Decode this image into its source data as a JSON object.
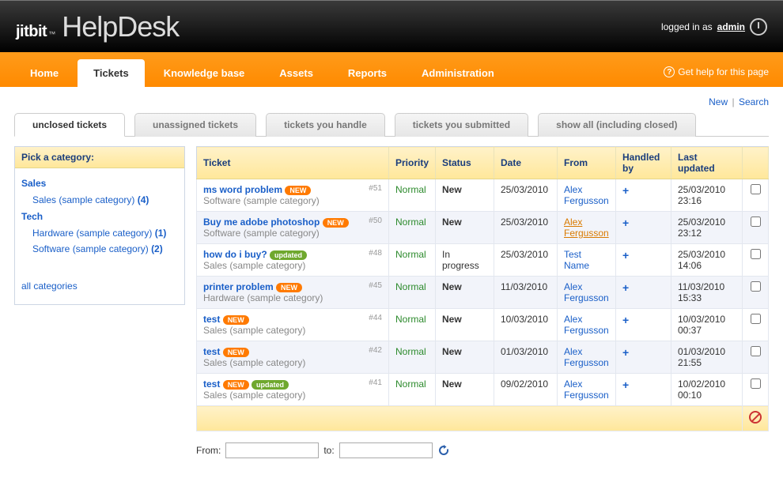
{
  "brand": {
    "jitbit": "jitbit",
    "tm": "™",
    "product": "HelpDesk"
  },
  "login": {
    "prefix": "logged in as ",
    "user": "admin"
  },
  "nav": {
    "tabs": [
      {
        "label": "Home"
      },
      {
        "label": "Tickets",
        "active": true
      },
      {
        "label": "Knowledge base"
      },
      {
        "label": "Assets"
      },
      {
        "label": "Reports"
      },
      {
        "label": "Administration"
      }
    ],
    "help": "Get help for this page"
  },
  "toplinks": {
    "new": "New",
    "search": "Search"
  },
  "subtabs": [
    {
      "label": "unclosed tickets",
      "active": true
    },
    {
      "label": "unassigned tickets"
    },
    {
      "label": "tickets you handle"
    },
    {
      "label": "tickets you submitted"
    },
    {
      "label": "show all (including closed)"
    }
  ],
  "sidebar": {
    "title": "Pick a category:",
    "groups": [
      {
        "name": "Sales",
        "items": [
          {
            "label": "Sales (sample category)",
            "count": "(4)"
          }
        ]
      },
      {
        "name": "Tech",
        "items": [
          {
            "label": "Hardware (sample category)",
            "count": "(1)"
          },
          {
            "label": "Software (sample category)",
            "count": "(2)"
          }
        ]
      }
    ],
    "all": "all categories"
  },
  "table": {
    "headers": {
      "ticket": "Ticket",
      "priority": "Priority",
      "status": "Status",
      "date": "Date",
      "from": "From",
      "handled": "Handled by",
      "updated": "Last updated"
    },
    "rows": [
      {
        "id": "#51",
        "title": "ms word problem",
        "badges": [
          "new"
        ],
        "cat": "Software (sample category)",
        "priority": "Normal",
        "status": "New",
        "date": "25/03/2010",
        "from": "Alex Fergusson",
        "handled": "+",
        "updated": "25/03/2010 23:16"
      },
      {
        "id": "#50",
        "title": "Buy me adobe photoshop",
        "badges": [
          "new"
        ],
        "cat": "Software (sample category)",
        "priority": "Normal",
        "status": "New",
        "date": "25/03/2010",
        "from": "Alex Fergusson",
        "from_hl": true,
        "handled": "+",
        "updated": "25/03/2010 23:12"
      },
      {
        "id": "#48",
        "title": "how do i buy?",
        "badges": [
          "updated"
        ],
        "cat": "Sales (sample category)",
        "priority": "Normal",
        "status": "In progress",
        "date": "25/03/2010",
        "from": "Test Name",
        "handled": "+",
        "updated": "25/03/2010 14:06"
      },
      {
        "id": "#45",
        "title": "printer problem",
        "badges": [
          "new"
        ],
        "cat": "Hardware (sample category)",
        "priority": "Normal",
        "status": "New",
        "date": "11/03/2010",
        "from": "Alex Fergusson",
        "handled": "+",
        "updated": "11/03/2010 15:33"
      },
      {
        "id": "#44",
        "title": "test",
        "badges": [
          "new"
        ],
        "cat": "Sales (sample category)",
        "priority": "Normal",
        "status": "New",
        "date": "10/03/2010",
        "from": "Alex Fergusson",
        "handled": "+",
        "updated": "10/03/2010 00:37"
      },
      {
        "id": "#42",
        "title": "test",
        "badges": [
          "new"
        ],
        "cat": "Sales (sample category)",
        "priority": "Normal",
        "status": "New",
        "date": "01/03/2010",
        "from": "Alex Fergusson",
        "handled": "+",
        "updated": "01/03/2010 21:55"
      },
      {
        "id": "#41",
        "title": "test",
        "badges": [
          "new",
          "updated"
        ],
        "cat": "Sales (sample category)",
        "priority": "Normal",
        "status": "New",
        "date": "09/02/2010",
        "from": "Alex Fergusson",
        "handled": "+",
        "updated": "10/02/2010 00:10"
      }
    ]
  },
  "badges": {
    "new": "NEW",
    "updated": "updated"
  },
  "datefilter": {
    "from": "From:",
    "to": "to:"
  }
}
